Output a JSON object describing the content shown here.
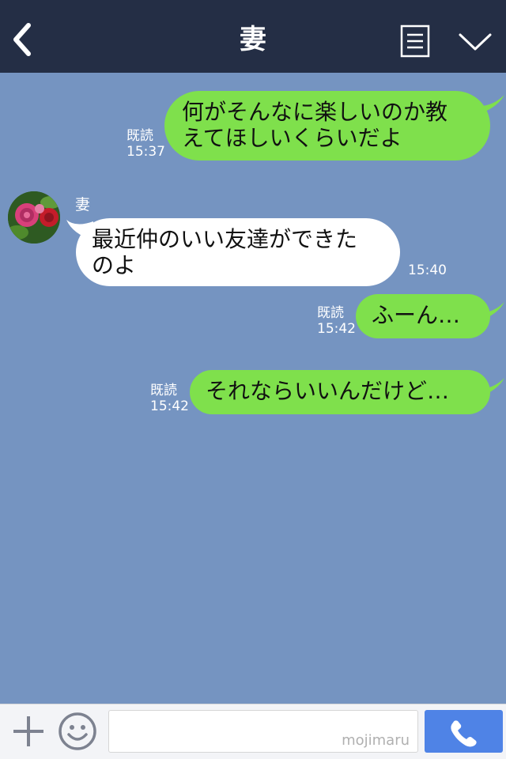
{
  "header": {
    "title": "妻",
    "back_icon": "chevron-left-icon",
    "menu_icon": "document-list-icon",
    "expand_icon": "chevron-down-icon",
    "background": "#242e45"
  },
  "chat": {
    "background": "#7594c1",
    "contact_name": "妻",
    "messages": [
      {
        "direction": "sent",
        "text": "何がそんなに楽しいのか教\nえてほしいくらいだよ",
        "read_label": "既読",
        "time": "15:37"
      },
      {
        "direction": "received",
        "text": "最近仲のいい友達ができた\nのよ",
        "time": "15:40"
      },
      {
        "direction": "sent",
        "text": "ふーん…",
        "read_label": "既読",
        "time": "15:42"
      },
      {
        "direction": "sent",
        "text": "それならいいんだけど…",
        "read_label": "既読",
        "time": "15:42"
      }
    ]
  },
  "colors": {
    "sent_bubble": "#7fe04c",
    "received_bubble": "#ffffff",
    "call_button": "#4f83e6"
  },
  "input_bar": {
    "plus_icon": "plus-icon",
    "emoji_icon": "smiley-icon",
    "watermark": "mojimaru",
    "call_icon": "phone-icon",
    "value": ""
  }
}
